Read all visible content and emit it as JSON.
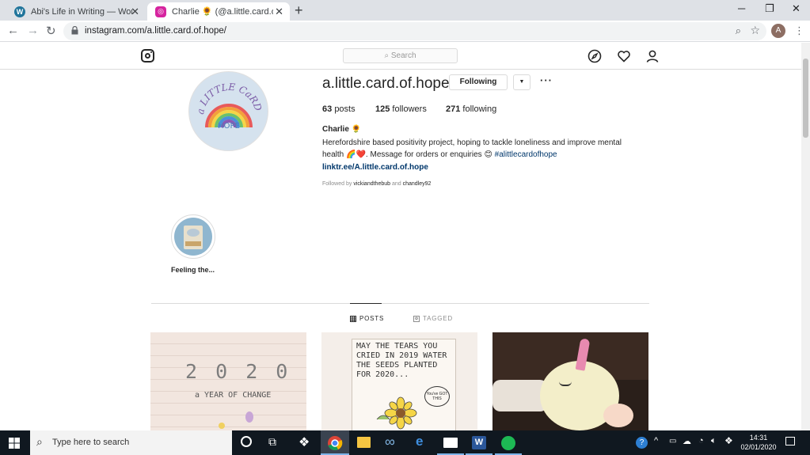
{
  "browser": {
    "tabs": [
      {
        "title": "Abi's Life in Writing — WordPres",
        "icon": "wordpress-icon"
      },
      {
        "title": "Charlie 🌻 (@a.little.card.of.hope",
        "icon": "instagram-icon"
      }
    ],
    "url": "instagram.com/a.little.card.of.hope/",
    "profile_initial": "A"
  },
  "instagram": {
    "search_placeholder": "Search",
    "username": "a.little.card.of.hope",
    "follow_label": "Following",
    "stats": {
      "posts_count": "63",
      "posts_label": "posts",
      "followers_count": "125",
      "followers_label": "followers",
      "following_count": "271",
      "following_label": "following"
    },
    "full_name": "Charlie 🌻",
    "bio_line1": "Herefordshire based positivity project, hoping to tackle loneliness and improve mental",
    "bio_line2_text": "health 🌈❤️. Message for orders or enquiries 😊",
    "bio_hashtag": "#alittlecardofhope",
    "link": "linktr.ee/A.little.card.of.hope",
    "followed_by_prefix": "Followed by",
    "followed_by_user1": "vickiandthebub",
    "followed_by_and": "and",
    "followed_by_user2": "chandley92",
    "profile_pic_text_top": "a LITTLE CaRD OF",
    "profile_pic_text_bottom": "HOPE",
    "highlight_label": "Feeling the...",
    "tabs": {
      "posts": "POSTS",
      "tagged": "TAGGED"
    },
    "posts": [
      {
        "text1": "2 0 2 0",
        "text2": "a YEAR OF CHANGE"
      },
      {
        "text1": "MAY THE TEARS YOU CRIED IN 2019 WATER THE SEEDS PLANTED FOR 2020...",
        "badge": "You've GOT THIS"
      },
      {
        "description": "unicorn plush"
      }
    ]
  },
  "taskbar": {
    "search_placeholder": "Type here to search",
    "time": "14:31",
    "date": "02/01/2020"
  }
}
